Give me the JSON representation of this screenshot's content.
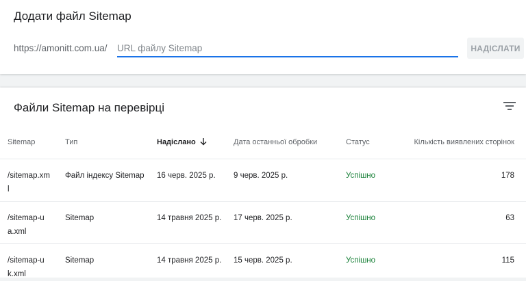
{
  "add_sitemap": {
    "title": "Додати файл Sitemap",
    "url_prefix": "https://amonitt.com.ua/",
    "input_placeholder": "URL файлу Sitemap",
    "input_value": "",
    "submit_label": "НАДІСЛАТИ"
  },
  "sitemaps": {
    "title": "Файли Sitemap на перевірці",
    "filter_icon": "filter-list-icon",
    "columns": {
      "sitemap": "Sitemap",
      "type": "Тип",
      "submitted": "Надіслано",
      "last_processed": "Дата останньої обробки",
      "status": "Статус",
      "discovered_pages": "Кількість виявлених сторінок"
    },
    "sort_icon": "arrow-down-icon",
    "rows": [
      {
        "sitemap": "/sitemap.xml",
        "type": "Файл індексу Sitemap",
        "submitted": "16 черв. 2025 р.",
        "last_processed": "9 черв. 2025 р.",
        "status": "Успішно",
        "discovered_pages": "178"
      },
      {
        "sitemap": "/sitemap-ua.xml",
        "type": "Sitemap",
        "submitted": "14 травня 2025 р.",
        "last_processed": "17 черв. 2025 р.",
        "status": "Успішно",
        "discovered_pages": "63"
      },
      {
        "sitemap": "/sitemap-uk.xml",
        "type": "Sitemap",
        "submitted": "14 травня 2025 р.",
        "last_processed": "15 черв. 2025 р.",
        "status": "Успішно",
        "discovered_pages": "115"
      }
    ]
  },
  "colors": {
    "accent": "#1a73e8",
    "success": "#188038",
    "background": "#f1f3f4"
  }
}
